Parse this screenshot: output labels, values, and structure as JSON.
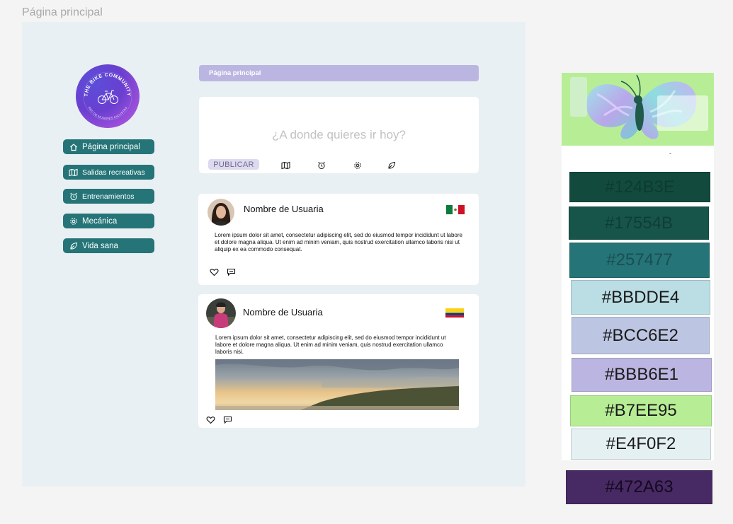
{
  "frame": {
    "title": "Página principal"
  },
  "logo": {
    "top_text": "THE BIKE COMMUNITY",
    "bottom_text": "RED DE MUJERES CICLISTAS"
  },
  "nav": {
    "items": [
      {
        "label": "Página principal",
        "icon": "home-icon"
      },
      {
        "label": "Salidas recreativas",
        "icon": "map-icon"
      },
      {
        "label": "Entrenamientos",
        "icon": "alarm-clock-icon"
      },
      {
        "label": "Mecánica",
        "icon": "gear-icon"
      },
      {
        "label": "Vida sana",
        "icon": "leaf-icon"
      }
    ]
  },
  "header": {
    "title": "Página principal"
  },
  "composer": {
    "prompt": "¿A donde quieres ir hoy?",
    "publish_label": "PUBLICAR",
    "tools": [
      "map-icon",
      "alarm-clock-icon",
      "gear-icon",
      "leaf-icon"
    ]
  },
  "posts": [
    {
      "username": "Nombre de Usuaria",
      "flag": "mexico-flag",
      "body": "Lorem ipsum dolor sit amet, consectetur adipiscing elit, sed do eiusmod tempor incididunt ut labore et dolore magna aliqua. Ut enim ad minim veniam, quis nostrud exercitation ullamco laboris nisi ut aliquip ex ea commodo consequat."
    },
    {
      "username": "Nombre de Usuaria",
      "flag": "colombia-flag",
      "body": "Lorem ipsum dolor sit amet, consectetur adipiscing elit, sed do eiusmod tempor incididunt ut labore et dolore magna aliqua. Ut enim ad minim veniam, quis nostrud exercitation ullamco laboris nisi.",
      "image": "coastal-sunset-photo"
    }
  ],
  "palette": {
    "dash": "-",
    "swatches": [
      {
        "label": "#124B3E",
        "color": "#124B3E",
        "text_color": "#0e3a30"
      },
      {
        "label": "#17554B",
        "color": "#17554B",
        "text_color": "#0f3d36"
      },
      {
        "label": "#257477",
        "color": "#257477",
        "text_color": "#1b4f52"
      },
      {
        "label": "#BBDDE4",
        "color": "#BBDDE4",
        "text_color": "#1a1a1a"
      },
      {
        "label": "#BCC6E2",
        "color": "#BCC6E2",
        "text_color": "#1a1a1a"
      },
      {
        "label": "#BBB6E1",
        "color": "#BBB6E1",
        "text_color": "#1a1a1a"
      },
      {
        "label": "#B7EE95",
        "color": "#B7EE95",
        "text_color": "#1a1a1a"
      },
      {
        "label": "#E4F0F2",
        "color": "#E4F0F2",
        "text_color": "#1a1a1a"
      },
      {
        "label": "#472A63",
        "color": "#472A63",
        "text_color": "#14091f"
      }
    ]
  }
}
